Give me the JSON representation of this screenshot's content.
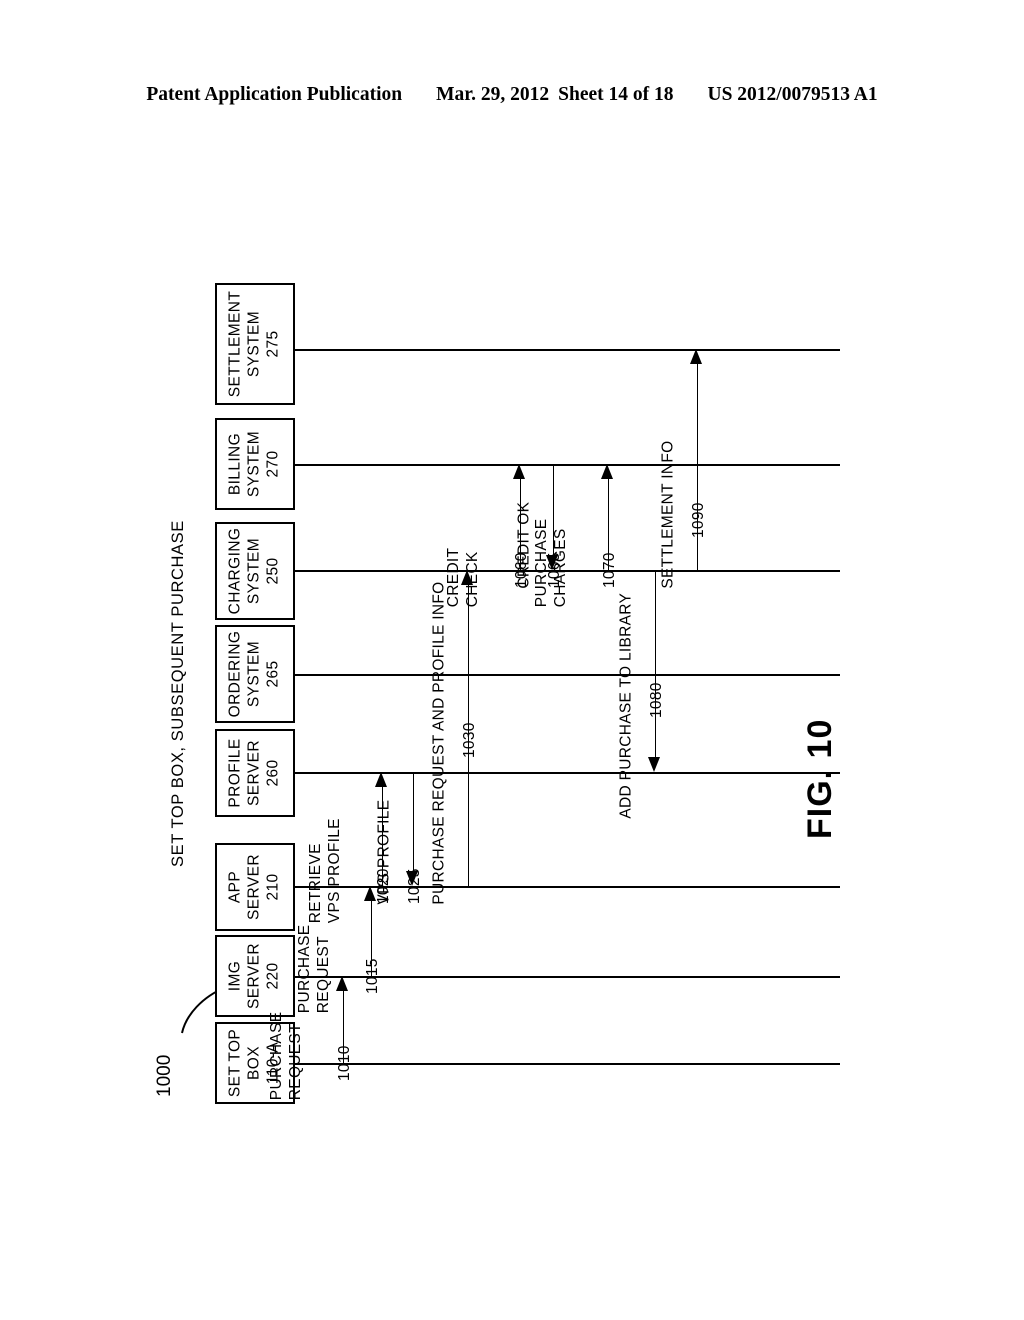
{
  "header": {
    "publication": "Patent Application Publication",
    "date": "Mar. 29, 2012",
    "sheet": "Sheet 14 of 18",
    "doc_number": "US 2012/0079513 A1"
  },
  "figure": {
    "number": "FIG. 10",
    "title": "SET TOP BOX, SUBSEQUENT PURCHASE",
    "reference_numeral": "1000",
    "type": "sequence-diagram",
    "participants": [
      {
        "id": "settlement-system",
        "line1": "SETTLEMENT",
        "line2": "SYSTEM",
        "ref": "275"
      },
      {
        "id": "billing-system",
        "line1": "BILLING",
        "line2": "SYSTEM",
        "ref": "270"
      },
      {
        "id": "charging-system",
        "line1": "CHARGING",
        "line2": "SYSTEM",
        "ref": "250"
      },
      {
        "id": "ordering-system",
        "line1": "ORDERING",
        "line2": "SYSTEM",
        "ref": "265"
      },
      {
        "id": "profile-server",
        "line1": "PROFILE",
        "line2": "SERVER",
        "ref": "260"
      },
      {
        "id": "app-server",
        "line1": "APP",
        "line2": "SERVER",
        "ref": "210"
      },
      {
        "id": "img-server",
        "line1": "IMG",
        "line2": "SERVER",
        "ref": "220"
      },
      {
        "id": "set-top-box",
        "line1": "SET TOP",
        "line2": "BOX",
        "ref": "110-A"
      }
    ],
    "messages": [
      {
        "id": "purchase-request-1010",
        "line1": "PURCHASE",
        "line2": "REQUEST",
        "ref": "1010",
        "from": "set-top-box",
        "to": "img-server",
        "direction": "up"
      },
      {
        "id": "purchase-request-1015",
        "line1": "PURCHASE",
        "line2": "REQUEST",
        "ref": "1015",
        "from": "img-server",
        "to": "app-server",
        "direction": "up"
      },
      {
        "id": "retrieve-vps-profile-1020",
        "line1": "RETRIEVE",
        "line2": "VPS PROFILE",
        "ref": "1020",
        "from": "app-server",
        "to": "profile-server",
        "direction": "up"
      },
      {
        "id": "vps-profile-1025",
        "line1": "",
        "line2": "VPS PROFILE",
        "ref": "1025",
        "from": "profile-server",
        "to": "app-server",
        "direction": "down"
      },
      {
        "id": "purchase-request-and-profile-info-1030",
        "line1": "",
        "line2": "PURCHASE REQUEST AND PROFILE INFO",
        "ref": "1030",
        "from": "app-server",
        "to": "charging-system",
        "direction": "up"
      },
      {
        "id": "credit-check-1060",
        "line1": "CREDIT",
        "line2": "CHECK",
        "ref": "1060",
        "from": "charging-system",
        "to": "billing-system",
        "direction": "up"
      },
      {
        "id": "credit-ok-1065",
        "line1": "",
        "line2": "CREDIT OK",
        "ref": "1065",
        "from": "billing-system",
        "to": "charging-system",
        "direction": "down"
      },
      {
        "id": "purchase-charges-1070",
        "line1": "PURCHASE",
        "line2": "CHARGES",
        "ref": "1070",
        "from": "charging-system",
        "to": "billing-system",
        "direction": "up"
      },
      {
        "id": "add-purchase-to-library-1080",
        "line1": "",
        "line2": "ADD PURCHASE TO LIBRARY",
        "ref": "1080",
        "from": "charging-system",
        "to": "profile-server",
        "direction": "down"
      },
      {
        "id": "settlement-info-1090",
        "line1": "",
        "line2": "SETTLEMENT INFO",
        "ref": "1090",
        "from": "charging-system",
        "to": "settlement-system",
        "direction": "up"
      }
    ]
  }
}
